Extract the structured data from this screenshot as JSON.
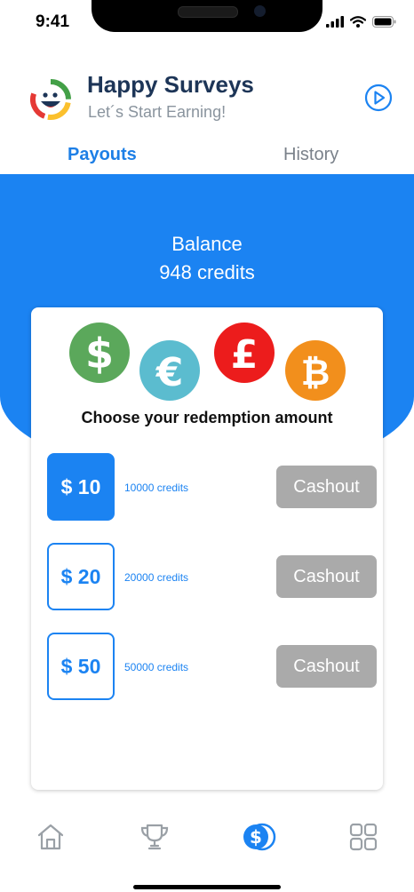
{
  "status_bar": {
    "time": "9:41",
    "icons": [
      "cellular-signal-icon",
      "wifi-icon",
      "battery-icon"
    ]
  },
  "header": {
    "title": "Happy Surveys",
    "subtitle": "Let´s Start Earning!",
    "logo": "smiley-logo-icon",
    "action_icon": "play-icon"
  },
  "tabs": [
    {
      "label": "Payouts",
      "active": true
    },
    {
      "label": "History",
      "active": false
    }
  ],
  "balance": {
    "label": "Balance",
    "value": "948 credits"
  },
  "redemption": {
    "currency_icons": [
      "dollar-icon",
      "euro-icon",
      "pound-icon",
      "bitcoin-icon"
    ],
    "heading": "Choose your redemption amount",
    "options": [
      {
        "amount": "$ 10",
        "credits": "10000 credits",
        "button": "Cashout",
        "selected": true
      },
      {
        "amount": "$ 20",
        "credits": "20000 credits",
        "button": "Cashout",
        "selected": false
      },
      {
        "amount": "$ 50",
        "credits": "50000 credits",
        "button": "Cashout",
        "selected": false
      }
    ]
  },
  "bottom_nav": [
    {
      "icon": "home-icon",
      "active": false
    },
    {
      "icon": "trophy-icon",
      "active": false
    },
    {
      "icon": "payout-coins-icon",
      "active": true
    },
    {
      "icon": "grid-icon",
      "active": false
    }
  ],
  "colors": {
    "primary": "#1b83f2",
    "title": "#1d3557",
    "cashout_disabled": "#aaaaaa",
    "dollar_coin": "#5ba85b",
    "euro_coin": "#5bbccf",
    "pound_coin": "#ec1c1c",
    "bitcoin_coin": "#f28f1c"
  }
}
